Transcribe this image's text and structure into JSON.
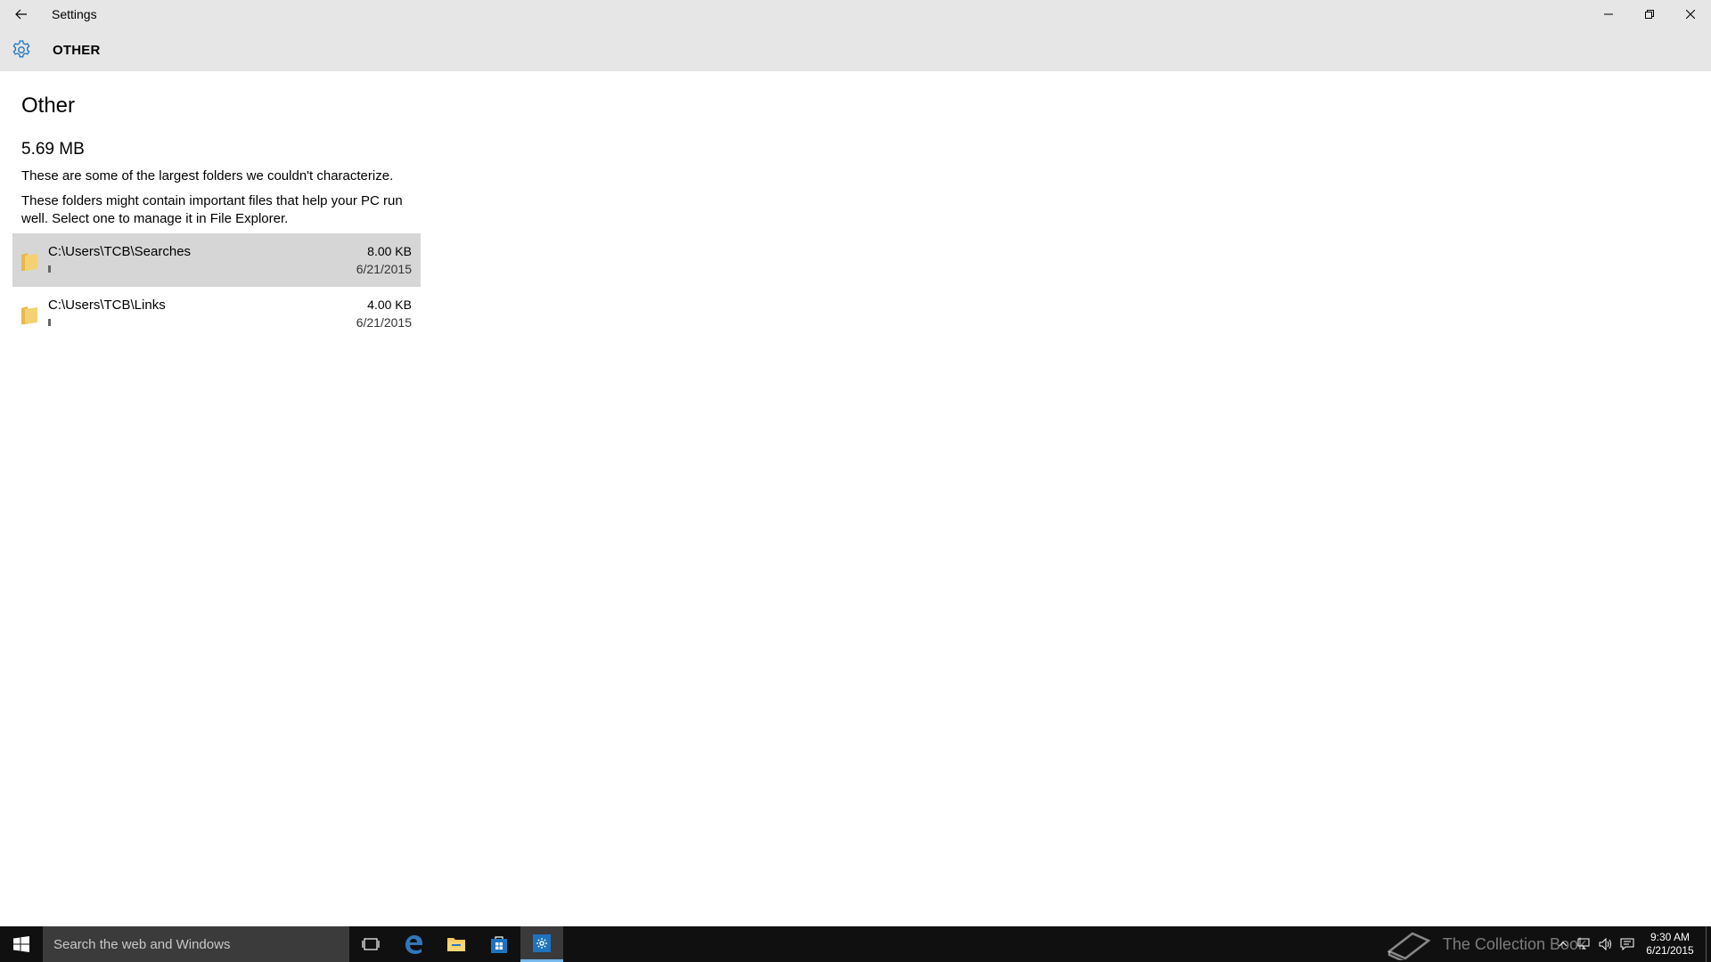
{
  "window": {
    "title": "Settings"
  },
  "header": {
    "section": "OTHER"
  },
  "main": {
    "title": "Other",
    "total_size": "5.69 MB",
    "description1": "These are some of the largest folders we couldn't characterize.",
    "description2": "These folders might contain important files that help your PC run well. Select one to manage it in File Explorer.",
    "folders": [
      {
        "path": "C:\\Users\\TCB\\Searches",
        "size": "8.00 KB",
        "date": "6/21/2015",
        "usage_fraction": 0.01,
        "selected": true
      },
      {
        "path": "C:\\Users\\TCB\\Links",
        "size": "4.00 KB",
        "date": "6/21/2015",
        "usage_fraction": 0.01,
        "selected": false
      }
    ]
  },
  "taskbar": {
    "search_placeholder": "Search the web and Windows",
    "clock_time": "9:30 AM",
    "clock_date": "6/21/2015",
    "watermark": "The Collection Book"
  },
  "colors": {
    "header_bg": "#e6e6e6",
    "accent": "#1e73be",
    "folder_yellow": "#f4d273",
    "taskbar_bg": "#101010"
  }
}
